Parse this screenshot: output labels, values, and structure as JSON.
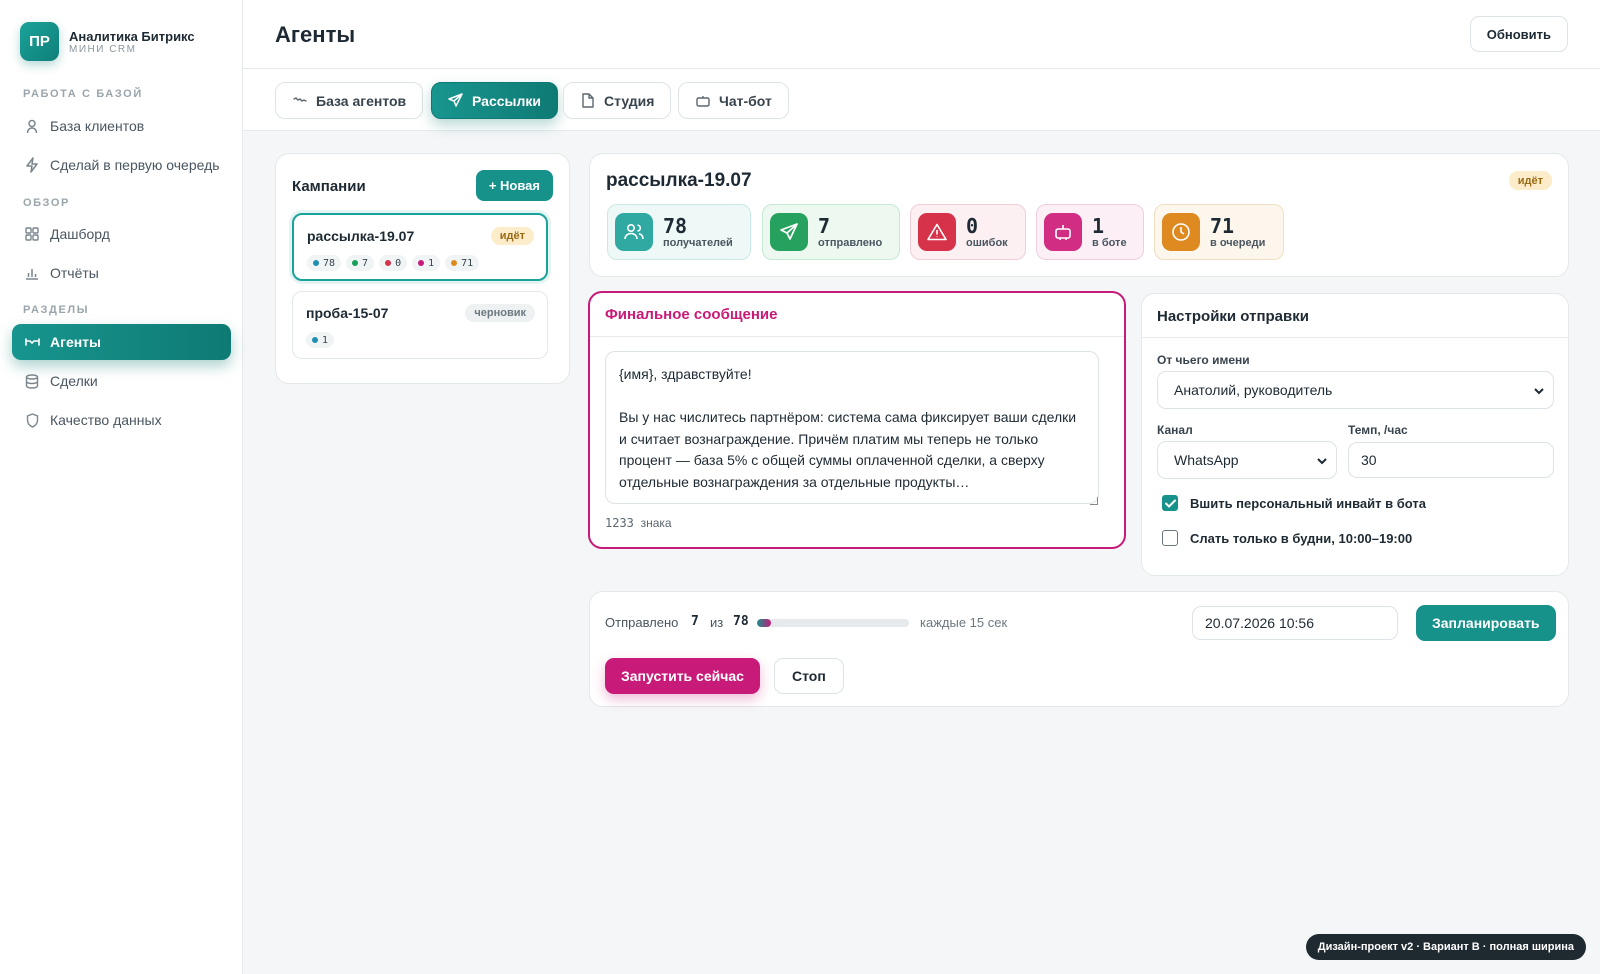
{
  "brand": {
    "logo": "ПР",
    "name": "Аналитика Битрикс",
    "sub": "МИНИ CRM"
  },
  "sidebar": {
    "sections": [
      {
        "title": "РАБОТА С БАЗОЙ"
      },
      {
        "title": "ОБЗОР"
      },
      {
        "title": "РАЗДЕЛЫ"
      }
    ],
    "items": [
      {
        "label": "База клиентов",
        "icon": "user-icon"
      },
      {
        "label": "Сделай в первую очередь",
        "icon": "bolt-icon"
      },
      {
        "label": "Дашборд",
        "icon": "grid-icon"
      },
      {
        "label": "Отчёты",
        "icon": "bar-chart-icon"
      },
      {
        "label": "Агенты",
        "icon": "handshake-icon",
        "active": true
      },
      {
        "label": "Сделки",
        "icon": "database-icon"
      },
      {
        "label": "Качество данных",
        "icon": "shield-icon"
      }
    ]
  },
  "header": {
    "title": "Агенты",
    "refresh_label": "Обновить"
  },
  "tabs": [
    {
      "label": "База агентов",
      "icon": "handshake-icon"
    },
    {
      "label": "Рассылки",
      "icon": "send-icon",
      "active": true
    },
    {
      "label": "Студия",
      "icon": "file-icon"
    },
    {
      "label": "Чат-бот",
      "icon": "bot-icon"
    }
  ],
  "campaigns": {
    "title": "Кампании",
    "new_label": "+ Новая",
    "items": [
      {
        "name": "рассылка-19.07",
        "status": "идёт",
        "chips": [
          "78",
          "7",
          "0",
          "1",
          "71"
        ]
      },
      {
        "name": "проба-15-07",
        "status": "черновик",
        "chips": [
          "1"
        ]
      }
    ]
  },
  "detail": {
    "title": "рассылка-19.07",
    "status": "идёт",
    "stats": [
      {
        "value": "78",
        "label": "получателей",
        "icon": "users-icon"
      },
      {
        "value": "7",
        "label": "отправлено",
        "icon": "send-icon"
      },
      {
        "value": "0",
        "label": "ошибок",
        "icon": "warning-icon"
      },
      {
        "value": "1",
        "label": "в боте",
        "icon": "bot-icon"
      },
      {
        "value": "71",
        "label": "в очереди",
        "icon": "clock-icon"
      }
    ]
  },
  "message": {
    "title": "Финальное сообщение",
    "text": "{имя}, здравствуйте!\n\nВы у нас числитесь партнёром: система сама фиксирует ваши сделки и считает вознаграждение. Причём платим мы теперь не только процент — база 5% с общей суммы оплаченной сделки, а сверху отдельные вознаграждения за отдельные продукты…",
    "count_value": "1233",
    "count_unit": "знака"
  },
  "settings": {
    "title": "Настройки отправки",
    "from_label": "От чьего имени",
    "from_value": "Анатолий, руководитель",
    "channel_label": "Канал",
    "channel_value": "WhatsApp",
    "rate_label": "Темп, /час",
    "rate_value": "30",
    "invite_label": "Вшить персональный инвайт в бота",
    "invite_checked": true,
    "weekdays_label": "Слать только в будни, 10:00–19:00",
    "weekdays_checked": false
  },
  "progress": {
    "sent_label": "Отправлено",
    "sent": "7",
    "of_label": "из",
    "total": "78",
    "fraction": 0.09,
    "interval": "каждые 15 сек",
    "schedule_value": "20.07.2026 10:56",
    "schedule_label": "Запланировать",
    "run_label": "Запустить сейчас",
    "stop_label": "Стоп"
  },
  "colors": {
    "accent": "#16928b",
    "magenta": "#c81a78",
    "blue_dot": "#1f8fb0",
    "green_dot": "#18a058",
    "red_dot": "#d6334a",
    "pink_dot": "#c81a78",
    "orange_dot": "#e08a1e"
  },
  "footer": {
    "label": "Дизайн-проект v2 · Вариант B · полная ширина"
  }
}
